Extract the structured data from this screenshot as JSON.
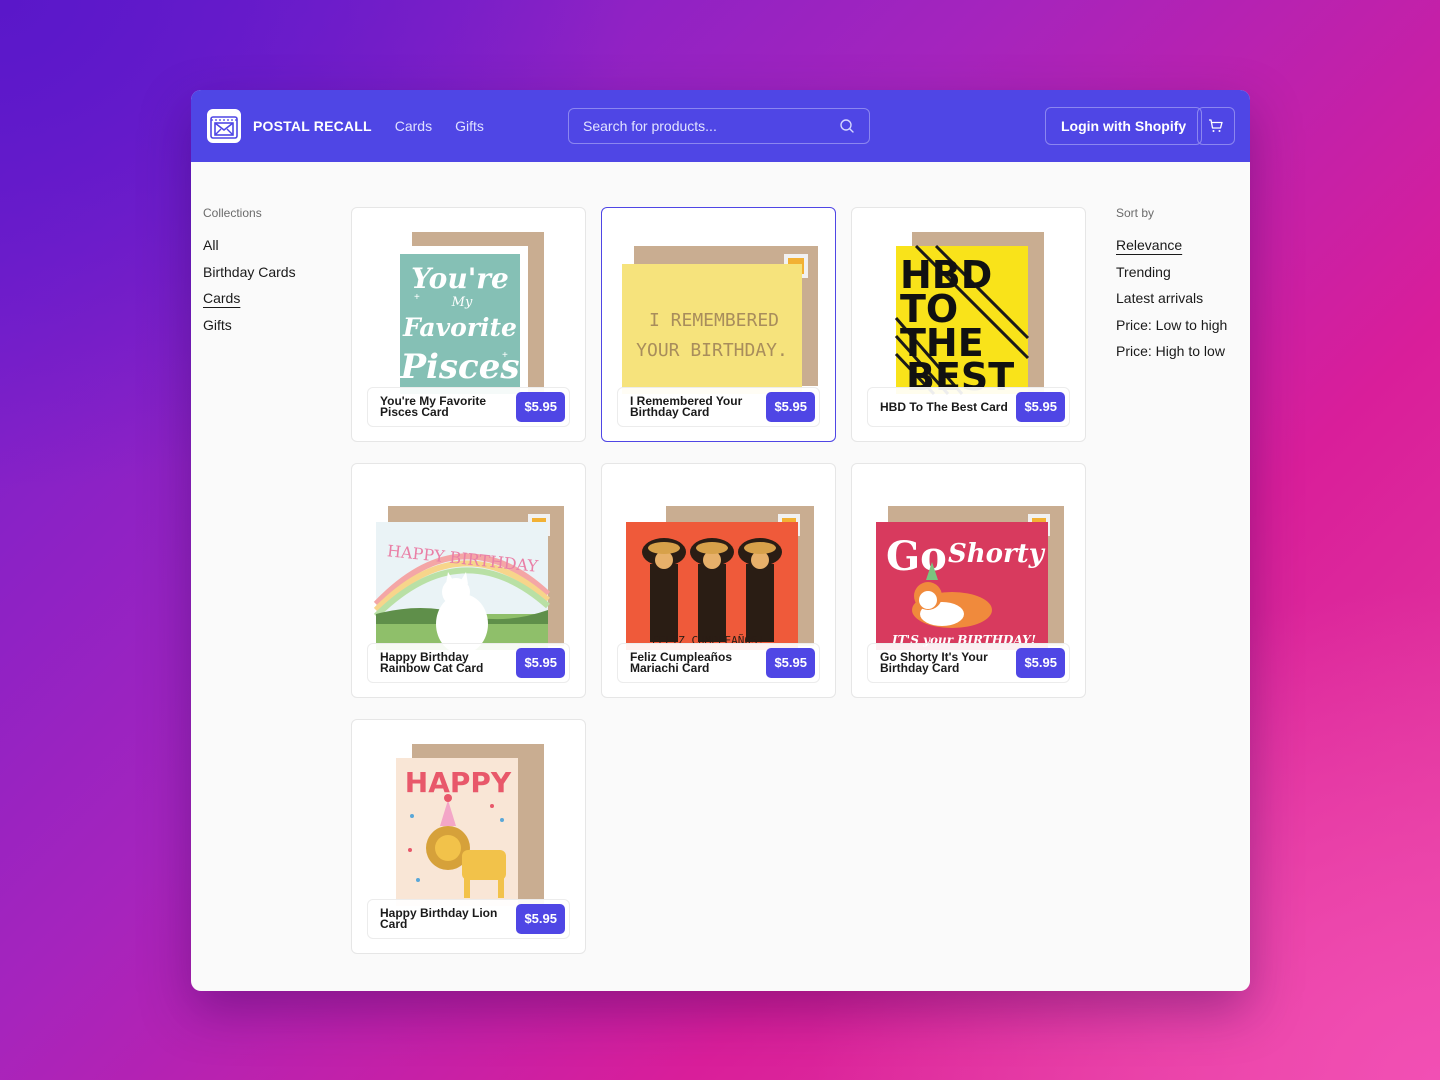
{
  "header": {
    "brand": "POSTAL RECALL",
    "nav": [
      {
        "label": "Cards"
      },
      {
        "label": "Gifts"
      }
    ],
    "search_placeholder": "Search for products...",
    "login_label": "Login with Shopify",
    "accent": "#4f46e5"
  },
  "collections": {
    "heading": "Collections",
    "items": [
      {
        "label": "All"
      },
      {
        "label": "Birthday Cards"
      },
      {
        "label": "Cards"
      },
      {
        "label": "Gifts"
      }
    ],
    "active": "Cards"
  },
  "sort": {
    "heading": "Sort by",
    "items": [
      {
        "label": "Relevance"
      },
      {
        "label": "Trending"
      },
      {
        "label": "Latest arrivals"
      },
      {
        "label": "Price: Low to high"
      },
      {
        "label": "Price: High to low"
      }
    ],
    "active": "Relevance"
  },
  "products": [
    {
      "name": "You're My Favorite Pisces Card",
      "price": "$5.95",
      "art_text": [
        "You're",
        "My",
        "Favorite",
        "Pisces"
      ]
    },
    {
      "name": "I Remembered Your Birthday Card",
      "price": "$5.95",
      "art_text": [
        "I REMEMBERED",
        "YOUR BIRTHDAY."
      ]
    },
    {
      "name": "HBD To The Best Card",
      "price": "$5.95",
      "art_text": [
        "HBD",
        "TO",
        "THE",
        "BEST"
      ]
    },
    {
      "name": "Happy Birthday Rainbow Cat Card",
      "price": "$5.95",
      "art_text": [
        "HAPPY BIRTHDAY"
      ]
    },
    {
      "name": "Feliz Cumpleaños Mariachi Card",
      "price": "$5.95",
      "art_text": [
        "FELIZ CUMPLEAÑOS!"
      ]
    },
    {
      "name": "Go Shorty It's Your Birthday Card",
      "price": "$5.95",
      "art_text": [
        "Go",
        "Shorty",
        "IT'S your BIRTHDAY!"
      ]
    },
    {
      "name": "Happy Birthday Lion Card",
      "price": "$5.95",
      "art_text": [
        "HAPPY"
      ]
    }
  ]
}
